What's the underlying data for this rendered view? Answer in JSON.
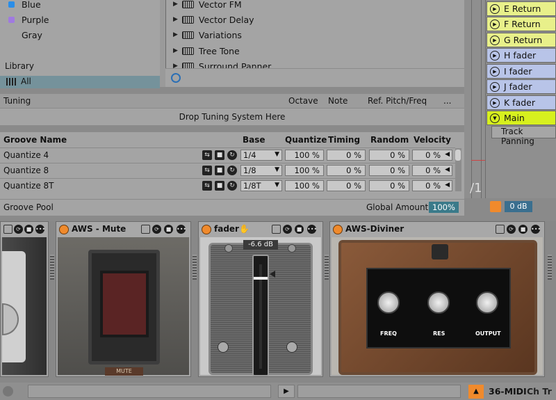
{
  "browser": {
    "colors": [
      {
        "label": "Blue",
        "color": "#2a8ee8"
      },
      {
        "label": "Purple",
        "color": "#a07ae0"
      },
      {
        "label": "Gray",
        "color": "#a4a4a4"
      }
    ],
    "library_label": "Library",
    "library_all": "All",
    "devices": [
      "Vector FM",
      "Vector Delay",
      "Variations",
      "Tree Tone",
      "Surround Panner"
    ]
  },
  "mixer": {
    "returns": [
      {
        "label": "E Return",
        "kind": "return"
      },
      {
        "label": "F Return",
        "kind": "return"
      },
      {
        "label": "G Return",
        "kind": "return"
      },
      {
        "label": "H fader",
        "kind": "track"
      },
      {
        "label": "I fader",
        "kind": "track"
      },
      {
        "label": "J fader",
        "kind": "track"
      },
      {
        "label": "K fader",
        "kind": "track"
      },
      {
        "label": "Main",
        "kind": "main"
      }
    ],
    "track_panning": "Track Panning",
    "fraction": "/1",
    "master_db": "0 dB"
  },
  "tuning": {
    "title": "Tuning",
    "octave": "Octave",
    "note": "Note",
    "ref": "Ref. Pitch/Freq",
    "more": "...",
    "drop": "Drop Tuning System Here"
  },
  "groove": {
    "headers": {
      "name": "Groove Name",
      "base": "Base",
      "quantize": "Quantize",
      "timing": "Timing",
      "random": "Random",
      "velocity": "Velocity"
    },
    "rows": [
      {
        "name": "Quantize 4",
        "base": "1/4",
        "quantize": "100 %",
        "timing": "0 %",
        "random": "0 %",
        "velocity": "0 %"
      },
      {
        "name": "Quantize 8",
        "base": "1/8",
        "quantize": "100 %",
        "timing": "0 %",
        "random": "0 %",
        "velocity": "0 %"
      },
      {
        "name": "Quantize 8T",
        "base": "1/8T",
        "quantize": "100 %",
        "timing": "0 %",
        "random": "0 %",
        "velocity": "0 %"
      }
    ],
    "pool_label": "Groove Pool",
    "global_amount_label": "Global Amount",
    "global_amount": "100%"
  },
  "devices": {
    "mute_title": "AWS - Mute",
    "mute_logo": "MUTE",
    "fader_title": "fader",
    "fader_db": "-6.6 dB",
    "diviner_title": "AWS-Diviner",
    "knobs": [
      {
        "label": "FREQ",
        "value": 0.55
      },
      {
        "label": "RES",
        "value": 0.5
      },
      {
        "label": "OUTPUT",
        "value": 0.5
      }
    ]
  },
  "status": {
    "midi_track": "36-MIDI",
    "midi_extra": "Ch Tr"
  }
}
